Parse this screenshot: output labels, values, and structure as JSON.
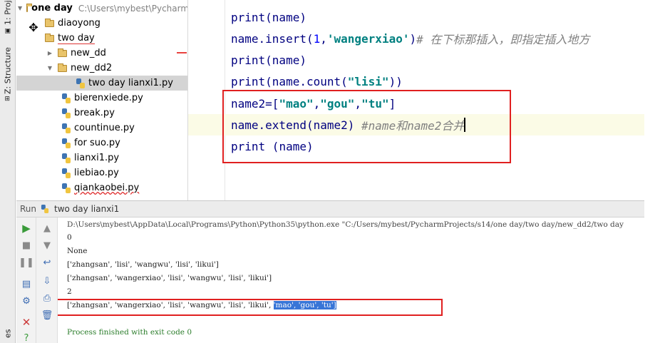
{
  "tool_strip": {
    "project_tab": "1: Proj",
    "structure_tab": "Z: Structure",
    "bottom_tab": "es"
  },
  "project_tree": {
    "root": {
      "label": "one day",
      "path": "C:\\Users\\mybest\\Pycharm"
    },
    "items": [
      {
        "label": "diaoyong",
        "type": "folder"
      },
      {
        "label": "two day",
        "type": "folder"
      },
      {
        "label": "new_dd",
        "type": "folder"
      },
      {
        "label": "new_dd2",
        "type": "folder"
      },
      {
        "label": "two day lianxi1.py",
        "type": "file"
      },
      {
        "label": "bierenxiede.py",
        "type": "file"
      },
      {
        "label": "break.py",
        "type": "file"
      },
      {
        "label": "countinue.py",
        "type": "file"
      },
      {
        "label": "for suo.py",
        "type": "file"
      },
      {
        "label": "lianxi1.py",
        "type": "file"
      },
      {
        "label": "liebiao.py",
        "type": "file"
      },
      {
        "label": "qiankaobei.py",
        "type": "file"
      }
    ]
  },
  "editor": {
    "lines": [
      {
        "p1": "print(name)"
      },
      {
        "p1": "name.insert(",
        "num": "1",
        "p2": ",",
        "str": "'wangerxiao'",
        "p3": ")",
        "comment": "# 在下标那插入，即指定插入地方"
      },
      {
        "p1": "print(name)"
      },
      {
        "p1": "print(name.count(",
        "str": "\"lisi\"",
        "p2": "))"
      },
      {
        "p1": "name2=[",
        "s1": "\"mao\"",
        "c1": ",",
        "s2": "\"gou\"",
        "c2": ",",
        "s3": "\"tu\"",
        "p2": "]"
      },
      {
        "p1": "name.extend(name2)",
        "comment": "#name和name2合并"
      },
      {
        "p1": "print",
        "p2": " (name)"
      }
    ]
  },
  "run_panel": {
    "title": "Run",
    "tab_name": "two day lianxi1",
    "console_lines": {
      "command": "D:\\Users\\mybest\\AppData\\Local\\Programs\\Python\\Python35\\python.exe \"C:/Users/mybest/PycharmProjects/s14/one day/two day/new_dd2/two day",
      "l1": "0",
      "l2": "None",
      "l3": "['zhangsan', 'lisi', 'wangwu', 'lisi', 'likui']",
      "l4": "['zhangsan', 'wangerxiao', 'lisi', 'wangwu', 'lisi', 'likui']",
      "l5": "2",
      "l6_prefix": "['zhangsan', 'wangerxiao', 'lisi', 'wangwu', 'lisi', 'likui', ",
      "l6_highlight": "'mao', 'gou', 'tu']",
      "exit": "Process finished with exit code 0"
    }
  },
  "colors": {
    "annotation_red": "#e02020",
    "selection_blue": "#3875d7",
    "keyword_navy": "#000080",
    "string_teal": "#008080",
    "comment_gray": "#808080"
  }
}
